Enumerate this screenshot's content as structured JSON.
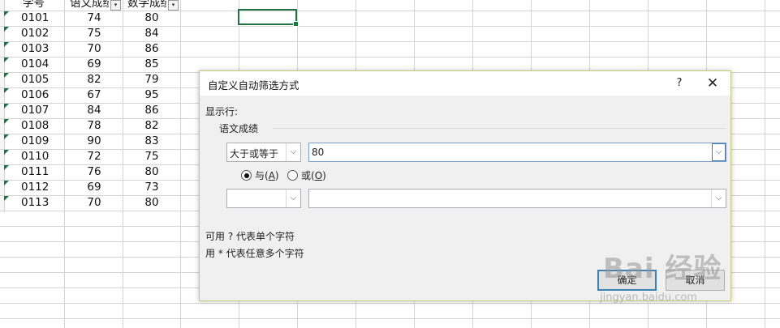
{
  "sheet": {
    "header": {
      "col_a": "学号",
      "col_b": "语文成绩",
      "col_c": "数学成绩",
      "filter_glyph": "▾"
    },
    "rows": [
      [
        "0101",
        "74",
        "80"
      ],
      [
        "0102",
        "75",
        "84"
      ],
      [
        "0103",
        "70",
        "86"
      ],
      [
        "0104",
        "69",
        "85"
      ],
      [
        "0105",
        "82",
        "79"
      ],
      [
        "0106",
        "67",
        "95"
      ],
      [
        "0107",
        "84",
        "86"
      ],
      [
        "0108",
        "78",
        "82"
      ],
      [
        "0109",
        "90",
        "83"
      ],
      [
        "0110",
        "72",
        "75"
      ],
      [
        "0111",
        "76",
        "80"
      ],
      [
        "0112",
        "69",
        "73"
      ],
      [
        "0113",
        "70",
        "80"
      ]
    ],
    "accent_color": "#217346"
  },
  "dialog": {
    "title": "自定义自动筛选方式",
    "help": "?",
    "close": "✕",
    "show_rows_label": "显示行:",
    "group_label": "语文成绩",
    "condition1": {
      "operator": "大于或等于",
      "value": "80"
    },
    "logic": {
      "and_label": "与(",
      "and_key": "A",
      "or_label": "或(",
      "or_key": "O",
      "close_paren": ")",
      "selected": "and"
    },
    "condition2": {
      "operator": "",
      "value": ""
    },
    "hint1": "可用 ? 代表单个字符",
    "hint2": "用 * 代表任意多个字符",
    "ok_label": "确定",
    "cancel_label": "取消"
  },
  "watermark": {
    "text": "Bai 经验",
    "sub": "jingyan.baidu.com"
  }
}
